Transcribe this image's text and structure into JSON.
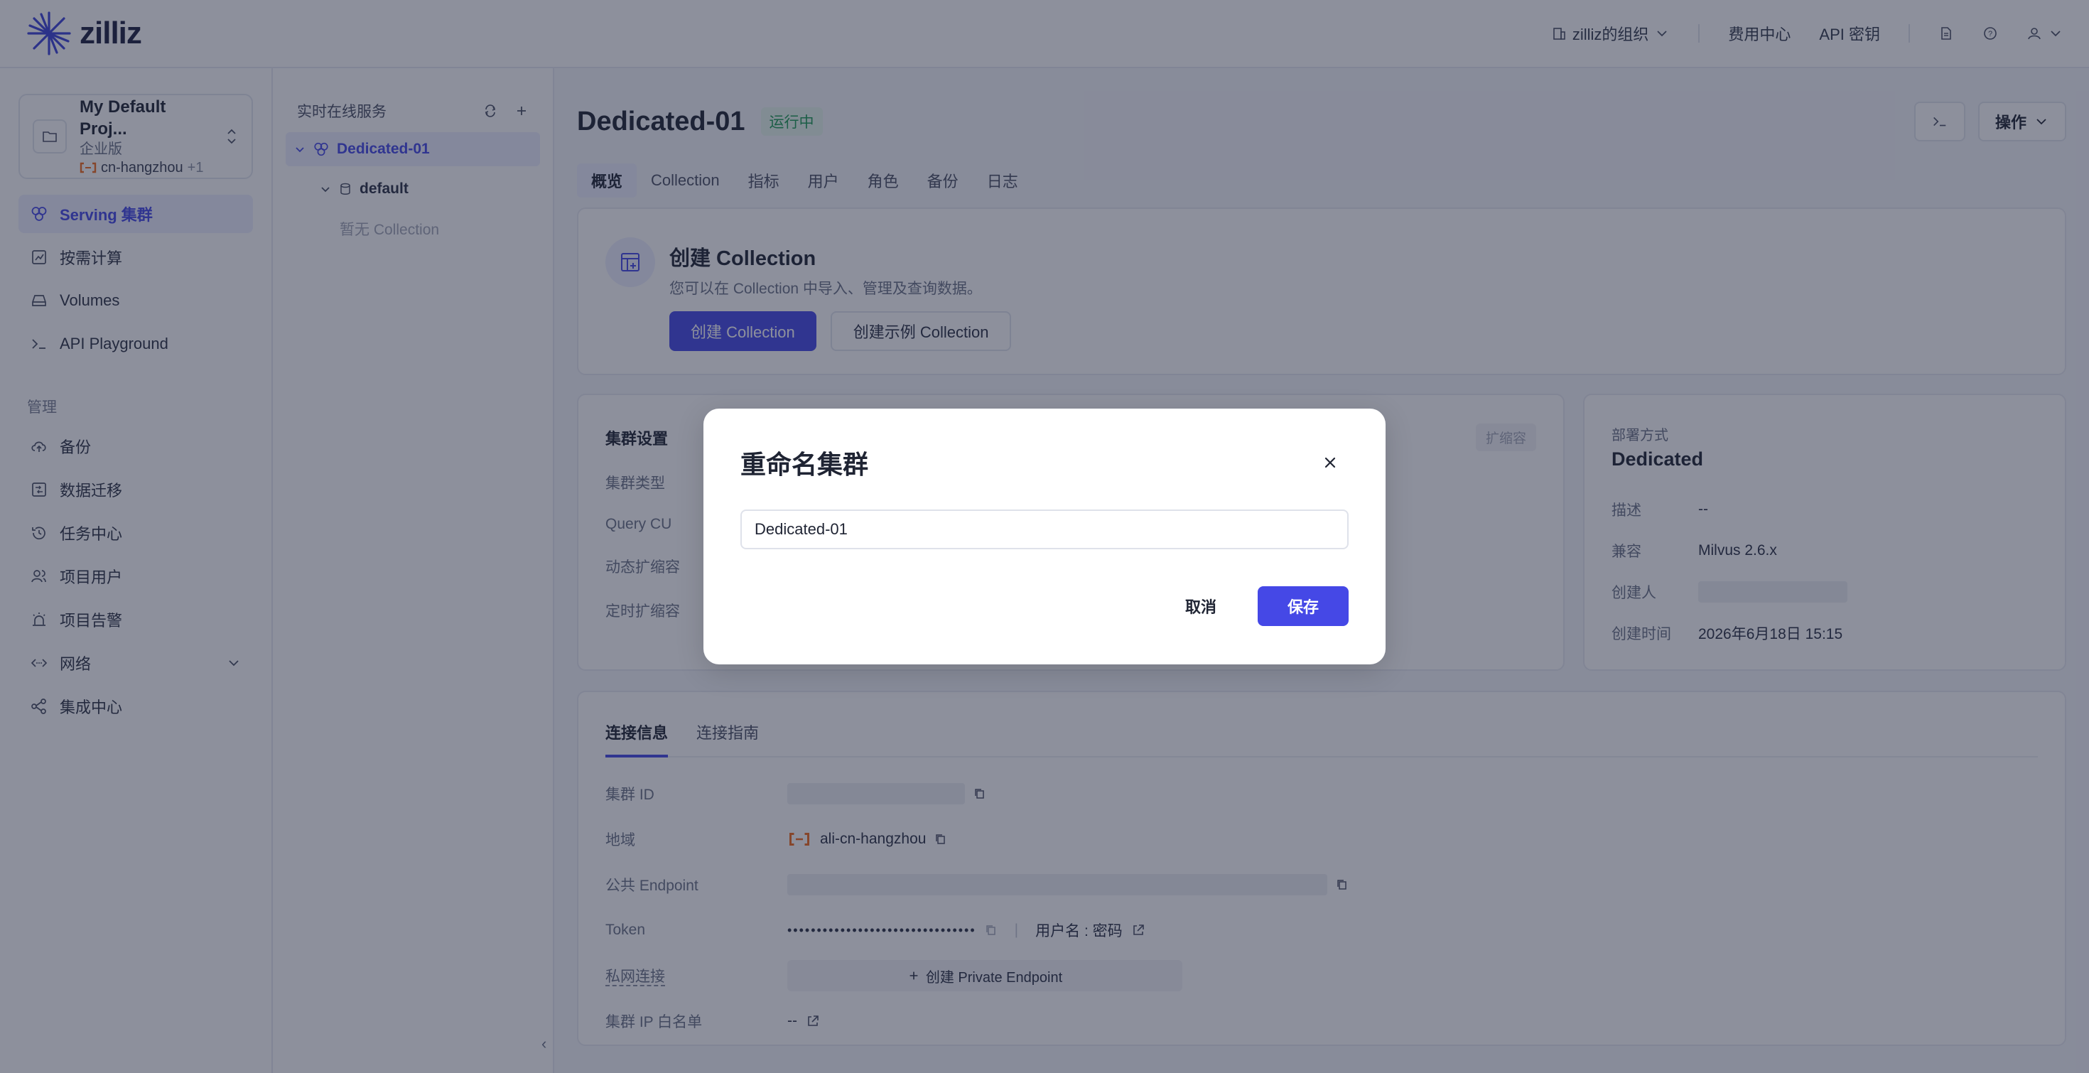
{
  "brand": {
    "name": "zilliz"
  },
  "topnav": {
    "org": "zilliz的组织",
    "billing": "费用中心",
    "api_key": "API 密钥"
  },
  "project": {
    "name": "My Default Proj...",
    "plan": "企业版",
    "region": "cn-hangzhou",
    "region_more": "+1"
  },
  "sidebar": {
    "items": [
      {
        "label": "Serving 集群",
        "icon": "cluster-icon",
        "active": true
      },
      {
        "label": "按需计算",
        "icon": "compute-icon"
      },
      {
        "label": "Volumes",
        "icon": "volume-icon"
      },
      {
        "label": "API Playground",
        "icon": "terminal-icon"
      }
    ],
    "group_label": "管理",
    "admin_items": [
      {
        "label": "备份",
        "icon": "cloud-upload-icon"
      },
      {
        "label": "数据迁移",
        "icon": "migration-icon"
      },
      {
        "label": "任务中心",
        "icon": "history-icon"
      },
      {
        "label": "项目用户",
        "icon": "users-icon"
      },
      {
        "label": "项目告警",
        "icon": "alarm-icon"
      },
      {
        "label": "网络",
        "icon": "network-icon"
      },
      {
        "label": "集成中心",
        "icon": "share-icon"
      }
    ]
  },
  "tree": {
    "header": "实时在线服务",
    "cluster": "Dedicated-01",
    "database": "default",
    "empty": "暂无 Collection"
  },
  "main": {
    "title": "Dedicated-01",
    "status": "运行中",
    "actions_label": "操作",
    "tabs": [
      "概览",
      "Collection",
      "指标",
      "用户",
      "角色",
      "备份",
      "日志"
    ]
  },
  "create_card": {
    "title": "创建 Collection",
    "desc": "您可以在 Collection 中导入、管理及查询数据。",
    "primary_btn": "创建 Collection",
    "secondary_btn": "创建示例 Collection"
  },
  "settings": {
    "title": "集群设置",
    "rows": [
      "集群类型",
      "Query CU",
      "动态扩缩容",
      "定时扩缩容"
    ],
    "expand": "扩缩容"
  },
  "deploy": {
    "label": "部署方式",
    "value": "Dedicated",
    "rows": [
      {
        "k": "描述",
        "v": "--"
      },
      {
        "k": "兼容",
        "v": "Milvus 2.6.x"
      },
      {
        "k": "创建人",
        "v": ""
      },
      {
        "k": "创建时间",
        "v": "2026年6月18日 15:15"
      }
    ]
  },
  "connection": {
    "tabs": [
      "连接信息",
      "连接指南"
    ],
    "cluster_id_label": "集群 ID",
    "region_label": "地域",
    "region_value": "ali-cn-hangzhou",
    "endpoint_label": "公共 Endpoint",
    "token_label": "Token",
    "token_value": "••••••••••••••••••••••••••••••••",
    "user_pass": "用户名 : 密码",
    "private_label": "私网连接",
    "private_btn": "创建 Private Endpoint",
    "whitelist_label": "集群 IP 白名单",
    "whitelist_value": "--"
  },
  "modal": {
    "title": "重命名集群",
    "input_value": "Dedicated-01",
    "cancel": "取消",
    "save": "保存"
  },
  "colors": {
    "primary": "#4548e6",
    "status_green": "#1c9b54",
    "alibaba_orange": "#f06a1d"
  }
}
